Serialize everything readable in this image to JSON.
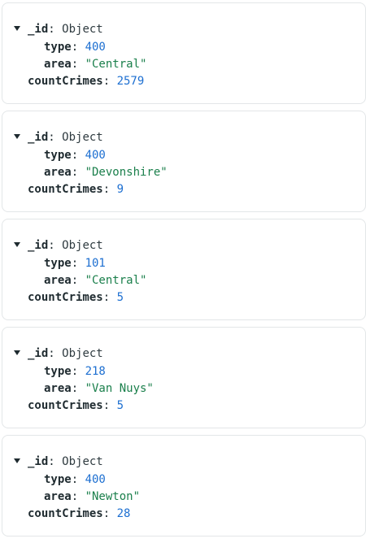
{
  "documents": [
    {
      "id_key": "_id",
      "id_value": "Object",
      "type_key": "type",
      "type_value": "400",
      "area_key": "area",
      "area_value": "\"Central\"",
      "count_key": "countCrimes",
      "count_value": "2579"
    },
    {
      "id_key": "_id",
      "id_value": "Object",
      "type_key": "type",
      "type_value": "400",
      "area_key": "area",
      "area_value": "\"Devonshire\"",
      "count_key": "countCrimes",
      "count_value": "9"
    },
    {
      "id_key": "_id",
      "id_value": "Object",
      "type_key": "type",
      "type_value": "101",
      "area_key": "area",
      "area_value": "\"Central\"",
      "count_key": "countCrimes",
      "count_value": "5"
    },
    {
      "id_key": "_id",
      "id_value": "Object",
      "type_key": "type",
      "type_value": "218",
      "area_key": "area",
      "area_value": "\"Van Nuys\"",
      "count_key": "countCrimes",
      "count_value": "5"
    },
    {
      "id_key": "_id",
      "id_value": "Object",
      "type_key": "type",
      "type_value": "400",
      "area_key": "area",
      "area_value": "\"Newton\"",
      "count_key": "countCrimes",
      "count_value": "28"
    }
  ],
  "icons": {
    "expand": "caret-down-icon"
  },
  "colors": {
    "key": "#1e2a2f",
    "number": "#1d6fd1",
    "string": "#1a7f4b",
    "card_border": "#e3e6e8"
  }
}
